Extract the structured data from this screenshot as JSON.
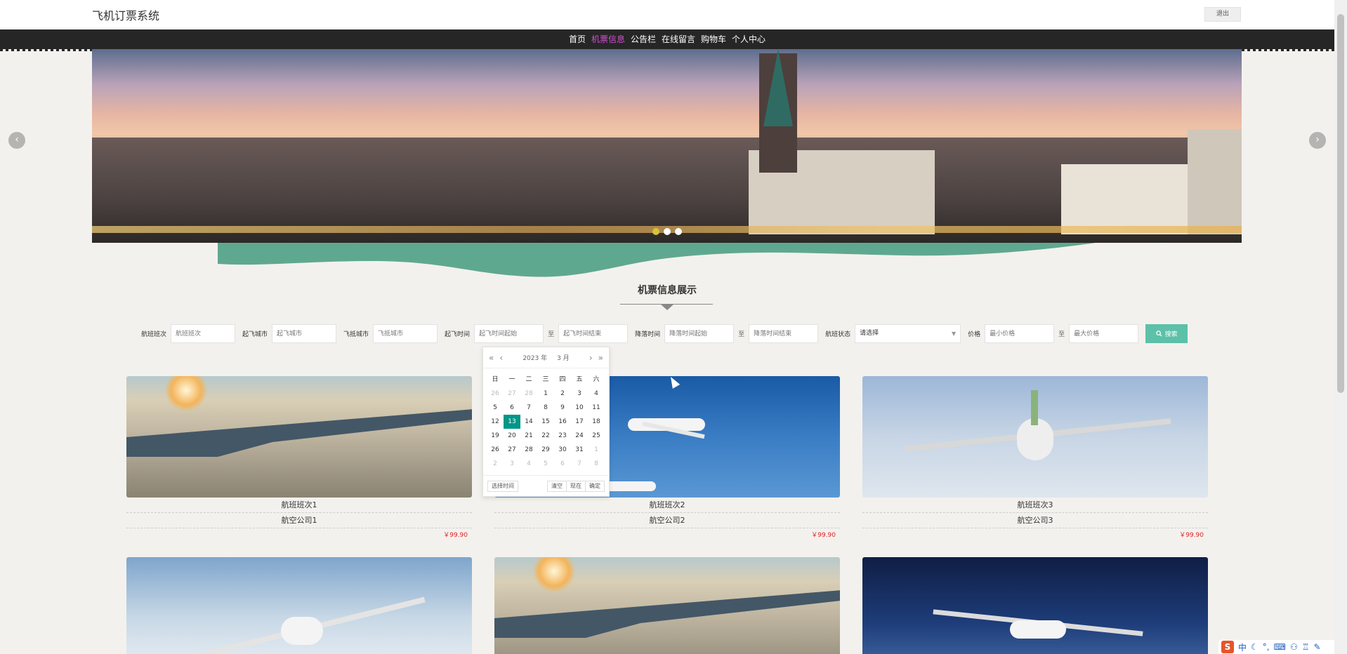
{
  "header": {
    "title": "飞机订票系统",
    "logout_label": "退出"
  },
  "nav": {
    "items": [
      {
        "label": "首页",
        "active": false
      },
      {
        "label": "机票信息",
        "active": true
      },
      {
        "label": "公告栏",
        "active": false
      },
      {
        "label": "在线留言",
        "active": false
      },
      {
        "label": "购物车",
        "active": false
      },
      {
        "label": "个人中心",
        "active": false
      }
    ]
  },
  "banner": {
    "prev_icon": "chevron-left-icon",
    "next_icon": "chevron-right-icon",
    "prev_glyph": "‹",
    "next_glyph": "›",
    "slide_count": 3,
    "active_slide": 1
  },
  "section": {
    "title": "机票信息展示"
  },
  "filter": {
    "flight_no": {
      "label": "航班班次",
      "placeholder": "航班班次"
    },
    "depart_city": {
      "label": "起飞城市",
      "placeholder": "起飞城市"
    },
    "arrive_city": {
      "label": "飞抵城市",
      "placeholder": "飞抵城市"
    },
    "depart_time": {
      "label": "起飞时间",
      "start_placeholder": "起飞时间起始",
      "end_placeholder": "起飞时间结束"
    },
    "land_time": {
      "label": "降落时间",
      "start_placeholder": "降落时间起始",
      "end_placeholder": "降落时间结束"
    },
    "status": {
      "label": "航班状态",
      "value": "请选择"
    },
    "price": {
      "label": "价格",
      "min_placeholder": "最小价格",
      "max_placeholder": "最大价格"
    },
    "range_sep": "至",
    "search_label": "搜索",
    "search_icon": "search-icon"
  },
  "datepicker": {
    "year": "2023 年",
    "month": "3 月",
    "weekdays": [
      "日",
      "一",
      "二",
      "三",
      "四",
      "五",
      "六"
    ],
    "days": [
      [
        "26",
        "27",
        "28",
        "1",
        "2",
        "3",
        "4"
      ],
      [
        "5",
        "6",
        "7",
        "8",
        "9",
        "10",
        "11"
      ],
      [
        "12",
        "13",
        "14",
        "15",
        "16",
        "17",
        "18"
      ],
      [
        "19",
        "20",
        "21",
        "22",
        "23",
        "24",
        "25"
      ],
      [
        "26",
        "27",
        "28",
        "29",
        "30",
        "31",
        "1"
      ],
      [
        "2",
        "3",
        "4",
        "5",
        "6",
        "7",
        "8"
      ]
    ],
    "selected": "13",
    "select_time_label": "选择时间",
    "clear_label": "清空",
    "now_label": "现在",
    "confirm_label": "确定"
  },
  "flights": [
    {
      "name": "航班班次1",
      "company": "航空公司1",
      "price": "￥99.90"
    },
    {
      "name": "航班班次2",
      "company": "航空公司2",
      "price": "￥99.90"
    },
    {
      "name": "航班班次3",
      "company": "航空公司3",
      "price": "￥99.90"
    },
    {
      "name": "",
      "company": "",
      "price": ""
    },
    {
      "name": "",
      "company": "",
      "price": ""
    },
    {
      "name": "",
      "company": "",
      "price": ""
    }
  ],
  "ime": {
    "logo": "S",
    "mode": "中"
  },
  "colors": {
    "nav_bg": "#262626",
    "nav_active": "#d24ed2",
    "accent": "#5cc1a8",
    "selected_day": "#009688",
    "price": "#dd2222"
  }
}
